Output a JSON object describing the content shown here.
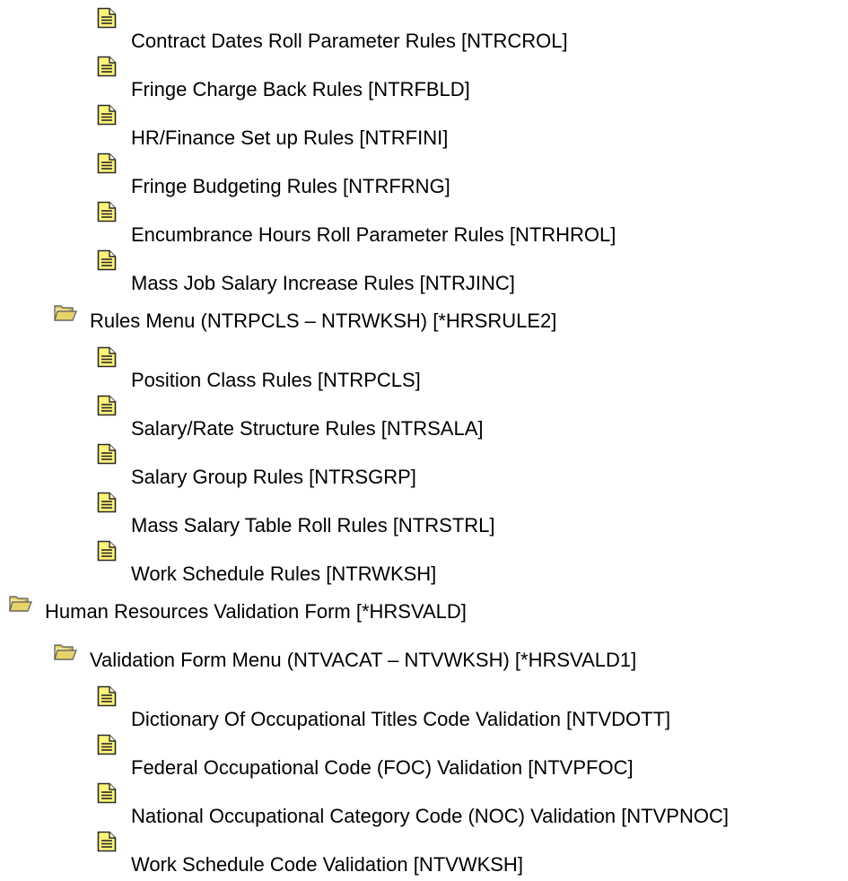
{
  "items": [
    {
      "type": "file",
      "label": "Contract Dates Roll Parameter Rules [NTRCROL]"
    },
    {
      "type": "file",
      "label": "Fringe Charge Back Rules [NTRFBLD]"
    },
    {
      "type": "file",
      "label": "HR/Finance Set up Rules [NTRFINI]"
    },
    {
      "type": "file",
      "label": "Fringe Budgeting Rules [NTRFRNG]"
    },
    {
      "type": "file",
      "label": "Encumbrance Hours Roll Parameter Rules [NTRHROL]"
    },
    {
      "type": "file",
      "label": "Mass Job Salary Increase Rules [NTRJINC]"
    },
    {
      "type": "folder",
      "label": "Rules Menu (NTRPCLS – NTRWKSH) [*HRSRULE2]"
    },
    {
      "type": "file",
      "label": "Position Class Rules [NTRPCLS]"
    },
    {
      "type": "file",
      "label": "Salary/Rate Structure Rules [NTRSALA]"
    },
    {
      "type": "file",
      "label": "Salary Group Rules [NTRSGRP]"
    },
    {
      "type": "file",
      "label": "Mass Salary Table Roll Rules [NTRSTRL]"
    },
    {
      "type": "file",
      "label": "Work Schedule Rules [NTRWKSH]"
    },
    {
      "type": "folder",
      "label": "Human Resources Validation Form [*HRSVALD]"
    },
    {
      "type": "folder",
      "label": "Validation Form Menu (NTVACAT – NTVWKSH) [*HRSVALD1]"
    },
    {
      "type": "file",
      "label": "Dictionary Of Occupational Titles Code Validation [NTVDOTT]"
    },
    {
      "type": "file",
      "label": "Federal Occupational Code (FOC) Validation [NTVPFOC]"
    },
    {
      "type": "file",
      "label": "National Occupational Category Code (NOC) Validation [NTVPNOC]"
    },
    {
      "type": "file",
      "label": "Work Schedule Code Validation [NTVWKSH]"
    }
  ],
  "colors": {
    "folder": "#e6d36a",
    "folder_dark": "#5a5a5a",
    "file": "#fff47a",
    "file_border": "#2a2a2a"
  }
}
